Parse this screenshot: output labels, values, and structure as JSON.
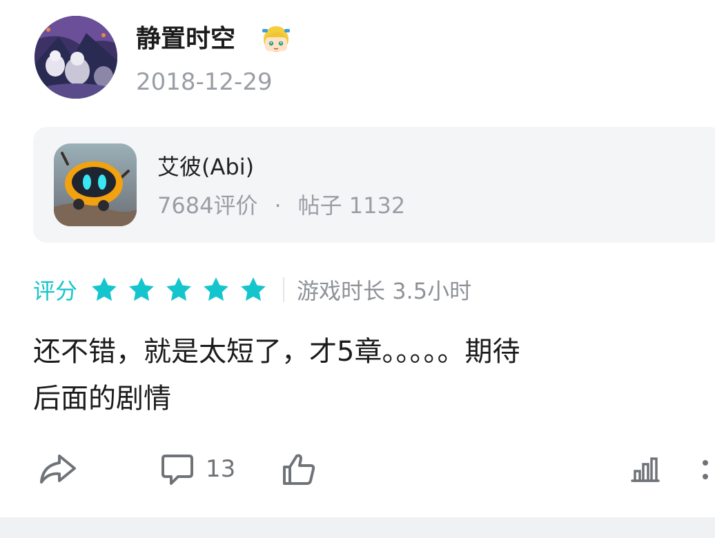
{
  "author": {
    "name": "静置时空",
    "date": "2018-12-29",
    "avatar_icon": "user-avatar",
    "badge_icon": "anime-girl-badge-icon"
  },
  "game": {
    "name": "艾彼(Abi)",
    "reviews": "7684评价",
    "separator": "·",
    "posts": "帖子 1132",
    "icon": "robot-game-icon"
  },
  "rating": {
    "label": "评分",
    "stars": 5,
    "max_stars": 5,
    "star_color": "#15c5ce",
    "playtime": "游戏时长 3.5小时"
  },
  "review": {
    "text_line1": "还不错，就是太短了，才5章。。。。。期待",
    "text_line2": "后面的剧情"
  },
  "actions": {
    "share_icon": "share-icon",
    "comment_icon": "comment-icon",
    "comment_count": "13",
    "like_icon": "thumbs-up-icon",
    "stats_icon": "bar-chart-icon",
    "more_icon": "more-vertical-icon"
  }
}
